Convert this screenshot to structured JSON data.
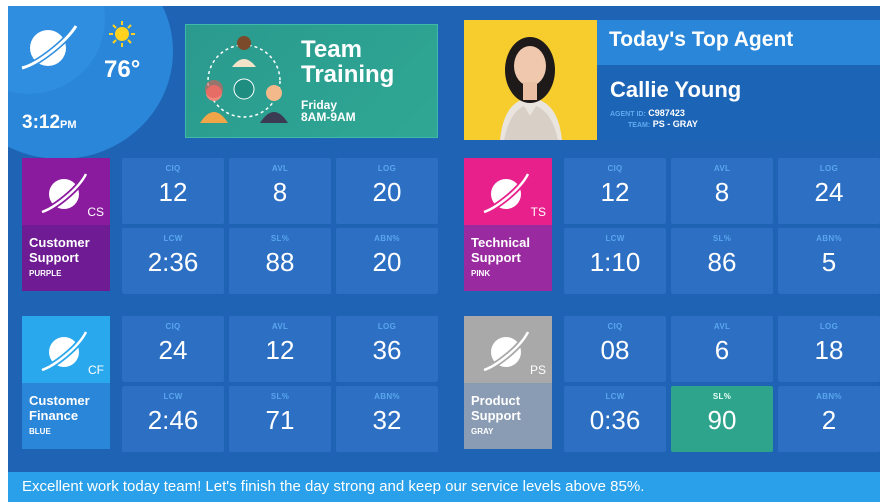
{
  "weather": {
    "temperature": "76°",
    "icon": "sun-icon"
  },
  "clock": {
    "time": "3:12",
    "ampm": "PM"
  },
  "training": {
    "title": "Team Training",
    "day": "Friday",
    "hours": "8AM-9AM"
  },
  "top_agent": {
    "title": "Today's Top Agent",
    "name": "Callie Young",
    "agent_id_label": "AGENT ID:",
    "agent_id": "C987423",
    "team_label": "TEAM:",
    "team": "PS - GRAY"
  },
  "teams": [
    {
      "code": "CS",
      "name_line1": "Customer",
      "name_line2": "Support",
      "color_name": "PURPLE",
      "icon_color": "#8a1a9e",
      "label_color": "#6f1b93",
      "stats": [
        {
          "label": "CIQ",
          "value": "12"
        },
        {
          "label": "AVL",
          "value": "8"
        },
        {
          "label": "LOG",
          "value": "20"
        },
        {
          "label": "LCW",
          "value": "2:36"
        },
        {
          "label": "SL%",
          "value": "88"
        },
        {
          "label": "ABN%",
          "value": "20"
        }
      ]
    },
    {
      "code": "TS",
      "name_line1": "Technical",
      "name_line2": "Support",
      "color_name": "PINK",
      "icon_color": "#e8208c",
      "label_color": "#9a2aa0",
      "stats": [
        {
          "label": "CIQ",
          "value": "12"
        },
        {
          "label": "AVL",
          "value": "8"
        },
        {
          "label": "LOG",
          "value": "24"
        },
        {
          "label": "LCW",
          "value": "1:10"
        },
        {
          "label": "SL%",
          "value": "86"
        },
        {
          "label": "ABN%",
          "value": "5"
        }
      ]
    },
    {
      "code": "CF",
      "name_line1": "Customer",
      "name_line2": "Finance",
      "color_name": "BLUE",
      "icon_color": "#2aa8ee",
      "label_color": "#2a86d8",
      "stats": [
        {
          "label": "CIQ",
          "value": "24"
        },
        {
          "label": "AVL",
          "value": "12"
        },
        {
          "label": "LOG",
          "value": "36"
        },
        {
          "label": "LCW",
          "value": "2:46"
        },
        {
          "label": "SL%",
          "value": "71"
        },
        {
          "label": "ABN%",
          "value": "32"
        }
      ]
    },
    {
      "code": "PS",
      "name_line1": "Product",
      "name_line2": "Support",
      "color_name": "GRAY",
      "icon_color": "#a9a9a9",
      "label_color": "#8a9bb4",
      "stats": [
        {
          "label": "CIQ",
          "value": "08"
        },
        {
          "label": "AVL",
          "value": "6"
        },
        {
          "label": "LOG",
          "value": "18"
        },
        {
          "label": "LCW",
          "value": "0:36"
        },
        {
          "label": "SL%",
          "value": "90"
        },
        {
          "label": "ABN%",
          "value": "2"
        }
      ]
    }
  ],
  "ticker": "Excellent work today team!  Let's finish the day strong and keep our service levels above 85%."
}
